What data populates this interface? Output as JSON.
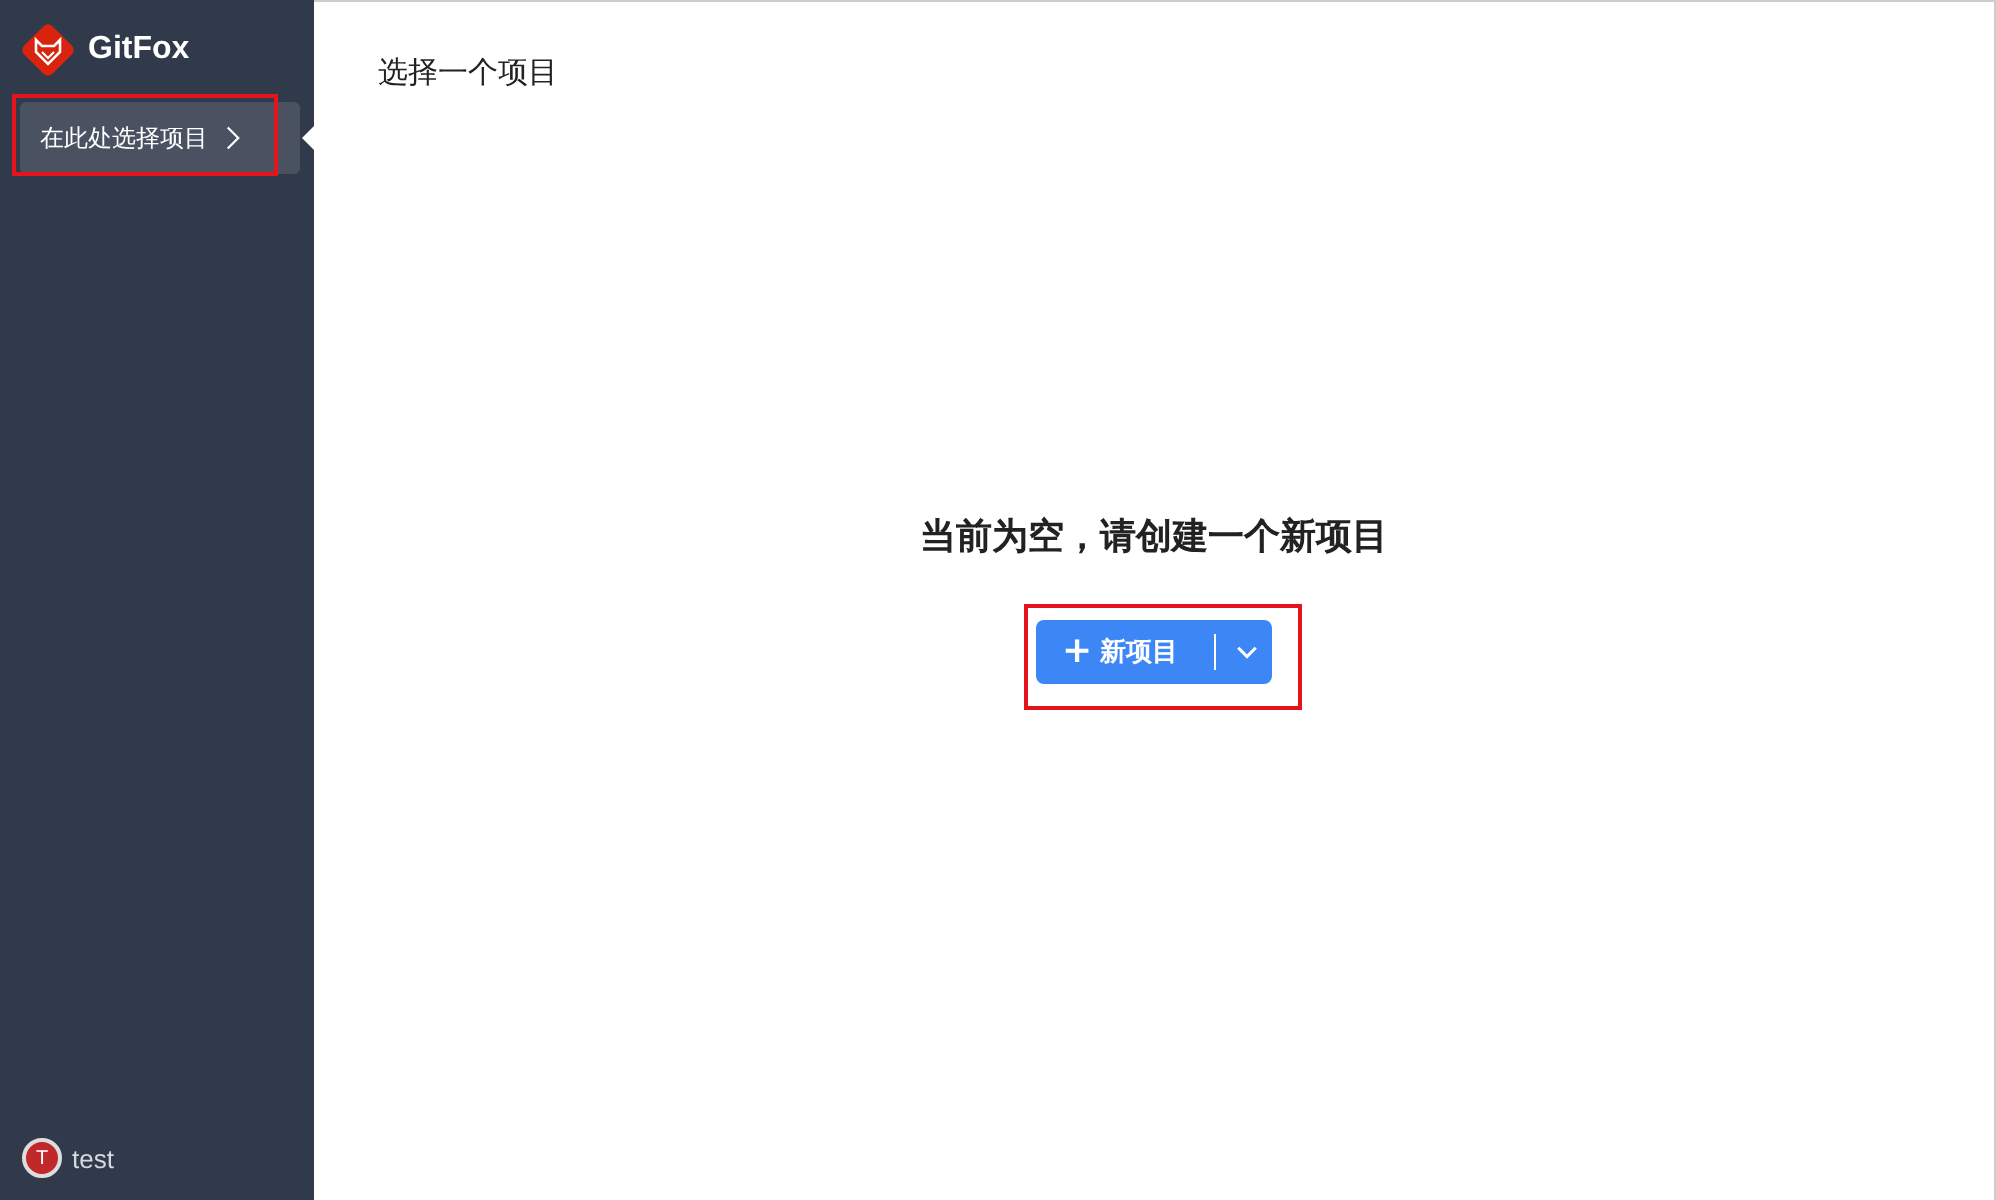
{
  "sidebar": {
    "logo": "GitFox",
    "project_selector": {
      "label": "在此处选择项目",
      "highlighted": true
    },
    "user": {
      "initial": "T",
      "name": "test"
    }
  },
  "main": {
    "title": "选择一个项目",
    "empty_message": "当前为空，请创建一个新项目",
    "new_button": {
      "icon": "+",
      "label": "新项目",
      "highlighted": true
    }
  }
}
